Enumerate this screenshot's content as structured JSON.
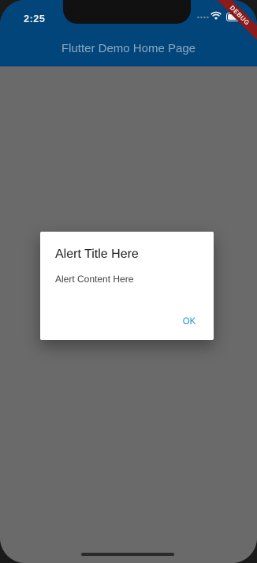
{
  "status_bar": {
    "time": "2:25",
    "icons": [
      "signal-icon",
      "wifi-icon",
      "battery-icon"
    ]
  },
  "debug_banner": {
    "label": "DEBUG",
    "color": "#8b1a1a"
  },
  "app_bar": {
    "title": "Flutter Demo Home Page",
    "color": "#02457a"
  },
  "dialog": {
    "title": "Alert Title Here",
    "content": "Alert Content Here",
    "ok_label": "OK",
    "accent": "#1a8fd8"
  }
}
